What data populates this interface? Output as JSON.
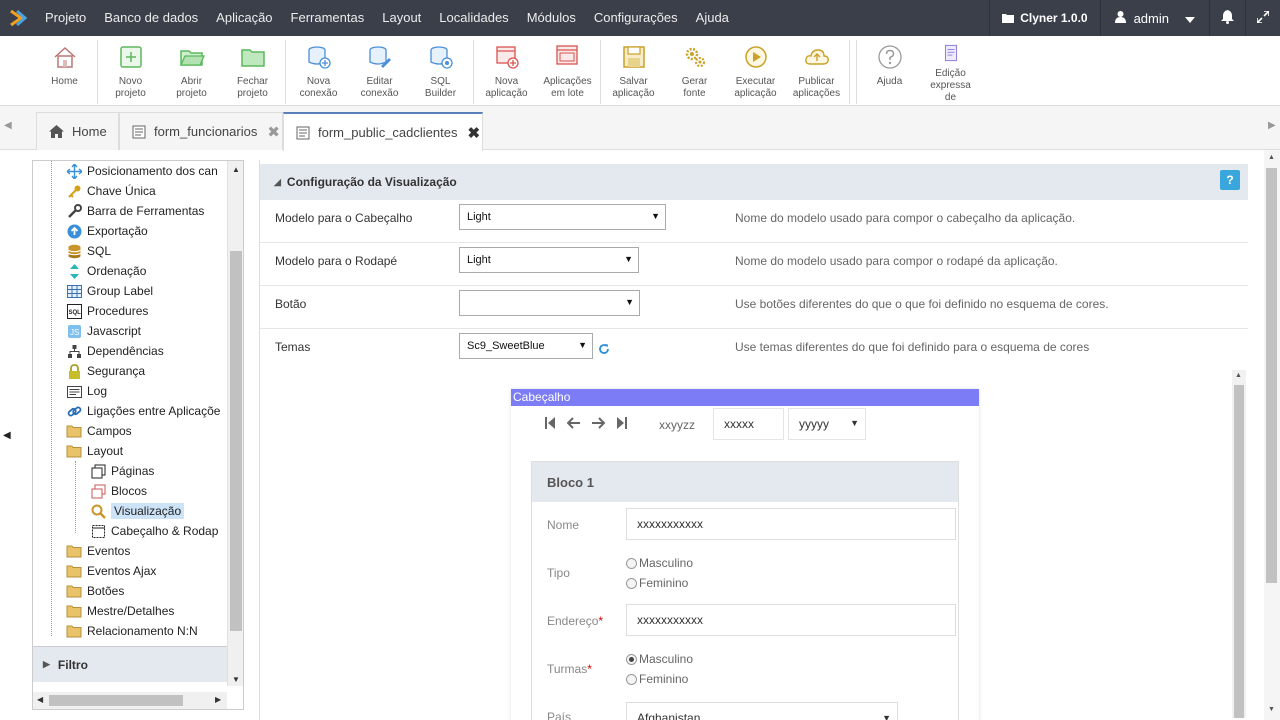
{
  "menu": {
    "items": [
      "Projeto",
      "Banco de dados",
      "Aplicação",
      "Ferramentas",
      "Layout",
      "Localidades",
      "Módulos",
      "Configurações",
      "Ajuda"
    ],
    "project_name": "Clyner 1.0.0",
    "user": "admin"
  },
  "toolbar": {
    "home": "Home",
    "novo_projeto": "Novo\nprojeto",
    "abrir_projeto": "Abrir\nprojeto",
    "fechar_projeto": "Fechar\nprojeto",
    "nova_conexao": "Nova\nconexão",
    "editar_conexao": "Editar\nconexão",
    "sql_builder": "SQL\nBuilder",
    "nova_aplicacao": "Nova\naplicação",
    "aplicacoes_lote": "Aplicações\nem lote",
    "salvar_aplicacao": "Salvar\naplicação",
    "gerar_fonte": "Gerar\nfonte",
    "executar_aplicacao": "Executar\naplicação",
    "publicar_aplicacoes": "Publicar\naplicações",
    "ajuda": "Ajuda",
    "edicao_expressa": "Edição\nexpressa\nde"
  },
  "tabs": [
    {
      "label": "Home"
    },
    {
      "label": "form_funcionarios"
    },
    {
      "label": "form_public_cadclientes"
    }
  ],
  "tree": {
    "items": [
      "Posicionamento dos can",
      "Chave Única",
      "Barra de Ferramentas",
      "Exportação",
      "SQL",
      "Ordenação",
      "Group Label",
      "Procedures",
      "Javascript",
      "Dependências",
      "Segurança",
      "Log",
      "Ligações entre Aplicaçõe",
      "Campos",
      "Layout",
      "Páginas",
      "Blocos",
      "Visualização",
      "Cabeçalho & Rodap",
      "Eventos",
      "Eventos Ajax",
      "Botões",
      "Mestre/Detalhes",
      "Relacionamento N:N"
    ],
    "filtro": "Filtro"
  },
  "section": {
    "title": "Configuração da Visualização",
    "help": "?"
  },
  "fields": [
    {
      "label": "Modelo para o Cabeçalho",
      "value": "Light",
      "hint": "Nome do modelo usado para compor o cabeçalho da aplicação."
    },
    {
      "label": "Modelo para o Rodapé",
      "value": "Light",
      "hint": "Nome do modelo usado para compor o rodapé da aplicação."
    },
    {
      "label": "Botão",
      "value": "",
      "hint": "Use botões diferentes do que o que foi definido no esquema de cores."
    },
    {
      "label": "Temas",
      "value": "Sc9_SweetBlue",
      "hint": "Use temas diferentes do que foi definido para o esquema de cores"
    }
  ],
  "preview": {
    "header": "Cabeçalho",
    "page_text": "xxyyzz",
    "box1": "xxxxx",
    "box2": "yyyyy",
    "block_title": "Bloco 1",
    "nome_label": "Nome",
    "nome_value": "xxxxxxxxxxx",
    "tipo_label": "Tipo",
    "tipo_opt1": "Masculino",
    "tipo_opt2": "Feminino",
    "endereco_label": "Endereço",
    "endereco_value": "xxxxxxxxxxx",
    "turmas_label": "Turmas",
    "turmas_opt1": "Masculino",
    "turmas_opt2": "Feminino",
    "pais_label": "País",
    "pais_value": "Afghanistan",
    "required_mark": "*"
  },
  "colors": {
    "menubar": "#3a3f4a",
    "preview_header": "#7b7cf6",
    "section_head": "#e4e8ef",
    "help": "#3aa7dc"
  }
}
